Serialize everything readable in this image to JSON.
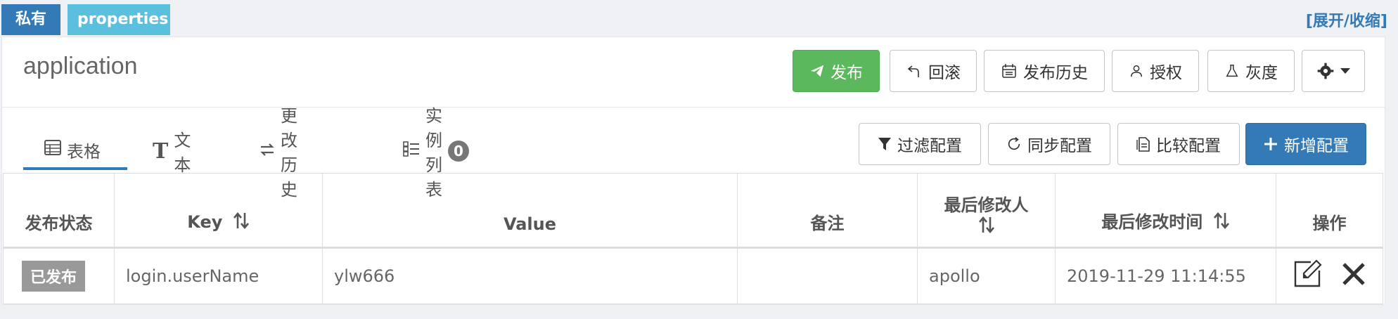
{
  "tags": {
    "scope": "私有",
    "format": "properties"
  },
  "toggle": "[展开/收缩]",
  "namespace": {
    "title": "application"
  },
  "toolbar": {
    "publish": "发布",
    "rollback": "回滚",
    "history": "发布历史",
    "auth": "授权",
    "gray": "灰度"
  },
  "tabs": {
    "table": "表格",
    "text": "文本",
    "history": "更改历史",
    "instances": "实例列表",
    "instances_count": "0"
  },
  "actions": {
    "filter": "过滤配置",
    "sync": "同步配置",
    "compare": "比较配置",
    "add": "新增配置"
  },
  "table": {
    "headers": {
      "status": "发布状态",
      "key": "Key",
      "value": "Value",
      "comment": "备注",
      "modifier": "最后修改人",
      "modified_time": "最后修改时间",
      "ops": "操作"
    },
    "rows": [
      {
        "status": "已发布",
        "key": "login.userName",
        "value": "ylw666",
        "comment": "",
        "modifier": "apollo",
        "modified_time": "2019-11-29 11:14:55"
      }
    ]
  },
  "colors": {
    "primary": "#337ab7",
    "success": "#5cb85c",
    "info": "#5bc0de",
    "muted": "#999999"
  }
}
